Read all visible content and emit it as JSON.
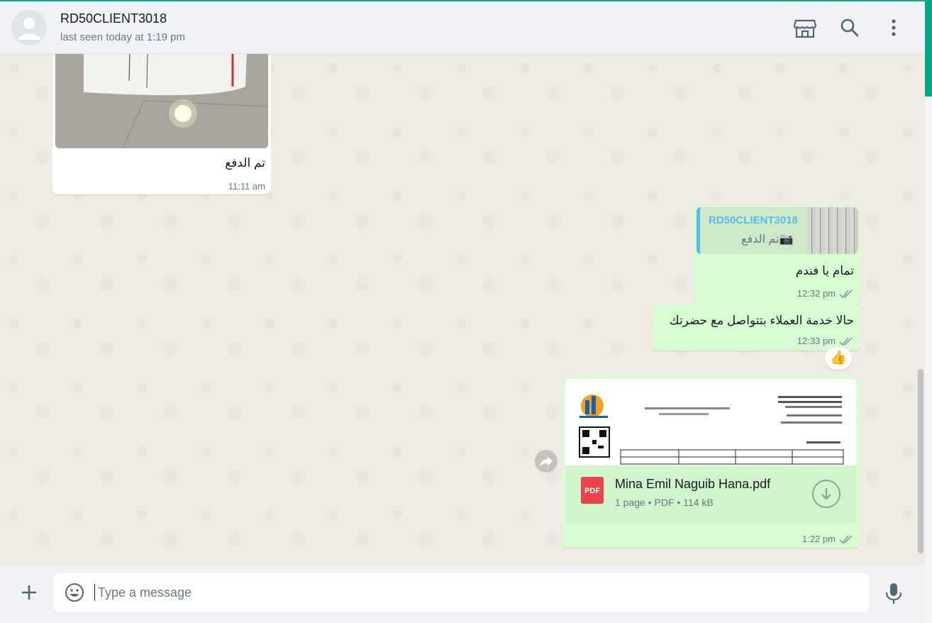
{
  "header": {
    "contact_name": "RD50CLIENT3018",
    "status": "last seen today at 1:19 pm",
    "icons": [
      "catalog-icon",
      "search-icon",
      "menu-icon"
    ]
  },
  "messages": [
    {
      "direction": "in",
      "type": "image",
      "caption": "تم الدفع",
      "time": "11:11 am"
    },
    {
      "direction": "out",
      "type": "reply",
      "quote_author": "RD50CLIENT3018",
      "quote_text": "تم الدفع",
      "text": "تمام يا فندم",
      "time": "12:32 pm"
    },
    {
      "direction": "out",
      "type": "text",
      "text": "حالا خدمة العملاء بتتواصل مع حضرتك",
      "time": "12:33 pm",
      "reaction": "👍"
    },
    {
      "direction": "out",
      "type": "document",
      "file_icon_label": "PDF",
      "file_name": "Mina Emil Naguib Hana.pdf",
      "pages": "1 page",
      "file_type": "PDF",
      "file_size": "114 kB",
      "time": "1:22 pm"
    }
  ],
  "composer": {
    "placeholder": "Type a message"
  },
  "colors": {
    "accent": "#00a884",
    "outgoing_bubble": "#d9fdd3",
    "incoming_bubble": "#ffffff",
    "chat_background": "#efeae2"
  }
}
